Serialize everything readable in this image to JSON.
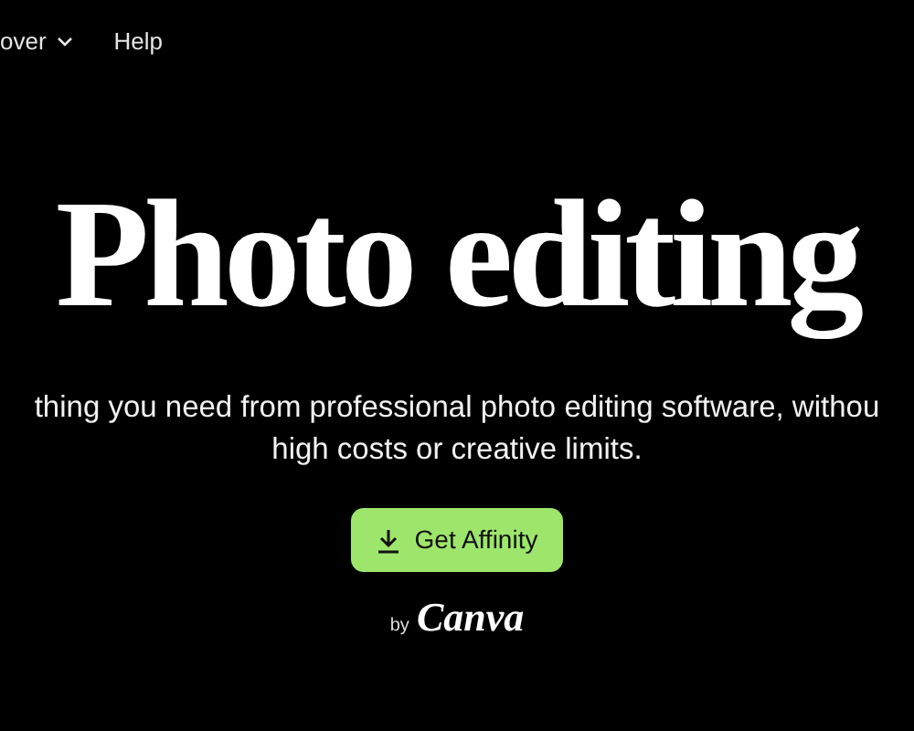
{
  "nav": [
    {
      "label": "over",
      "kind": "dropdown"
    },
    {
      "label": "Help",
      "kind": "link"
    }
  ],
  "hero": {
    "title": "Photo editing",
    "subtitle_lines": [
      "thing you need from professional photo editing software, withou",
      "high costs or creative limits."
    ]
  },
  "cta": {
    "label": "Get Affinity"
  },
  "brand": {
    "prefix": "by",
    "name": "Canva"
  }
}
